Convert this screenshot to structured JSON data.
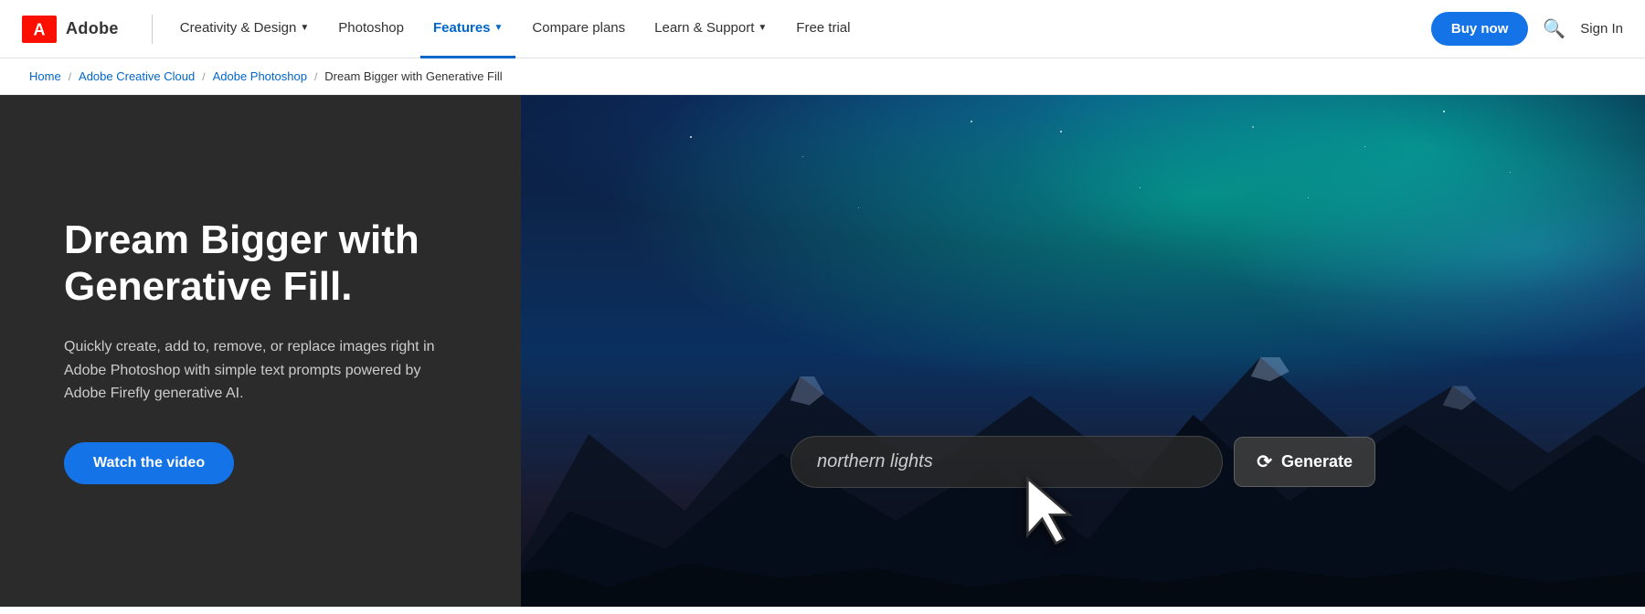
{
  "brand": {
    "logo_alt": "Adobe",
    "logo_text": "Adobe"
  },
  "nav": {
    "creativity_design": "Creativity & Design",
    "photoshop": "Photoshop",
    "features": "Features",
    "compare_plans": "Compare plans",
    "learn_support": "Learn & Support",
    "free_trial": "Free trial",
    "buy_now": "Buy now",
    "sign_in": "Sign In",
    "search_placeholder": "Search"
  },
  "breadcrumb": {
    "home": "Home",
    "creative_cloud": "Adobe Creative Cloud",
    "photoshop": "Adobe Photoshop",
    "current": "Dream Bigger with Generative Fill"
  },
  "hero": {
    "title": "Dream Bigger with Generative Fill.",
    "description": "Quickly create, add to, remove, or replace images right in Adobe Photoshop with simple text prompts powered by Adobe Firefly generative AI.",
    "watch_video_label": "Watch the video",
    "gen_fill_prompt": "northern lights",
    "generate_label": "Generate"
  }
}
